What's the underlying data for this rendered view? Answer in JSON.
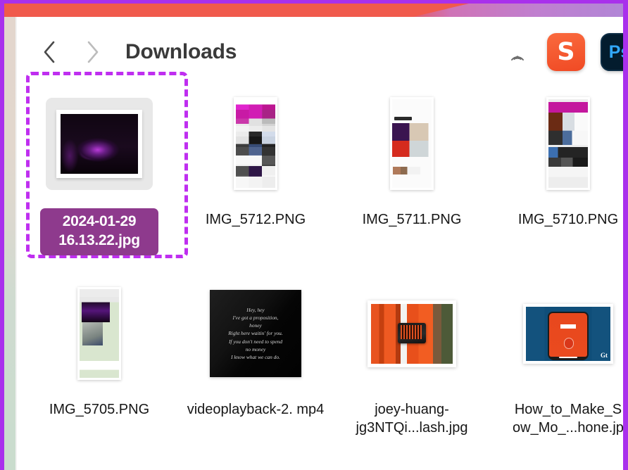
{
  "window": {
    "title": "Downloads",
    "nav": {
      "back_label": "Back",
      "forward_label": "Forward"
    }
  },
  "toolbar": {
    "airdrop_icon": "airdrop-icon",
    "apps": [
      {
        "name": "shottr-app-icon",
        "glyph": "S"
      },
      {
        "name": "photoshop-app-icon",
        "glyph": "Ps"
      }
    ]
  },
  "files": [
    {
      "name": "2024-01-29 16.13.22.jpg",
      "label_line1": "2024-01-29",
      "label_line2": "16.13.22.jpg",
      "selected": true,
      "kind": "photo-framed"
    },
    {
      "name": "IMG_5712.PNG",
      "selected": false,
      "kind": "phone-screenshot"
    },
    {
      "name": "IMG_5711.PNG",
      "selected": false,
      "kind": "phone-screenshot"
    },
    {
      "name": "IMG_5710.PNG",
      "selected": false,
      "kind": "phone-screenshot"
    },
    {
      "name": "IMG_5705.PNG",
      "selected": false,
      "kind": "phone-screenshot"
    },
    {
      "name": "videoplayback-2.\nmp4",
      "selected": false,
      "kind": "video-lyric-card",
      "lyrics": "Hey, hey\nI've got a proposition,\nhoney\nRight here waitin' for you.\nIf you don't need to spend\nno money\nI know what we can do."
    },
    {
      "name": "joey-huang-\njg3NTQi...lash.jpg",
      "selected": false,
      "kind": "photo"
    },
    {
      "name": "How_to_Make_S\now_Mo_...hone.jp",
      "selected": false,
      "kind": "photo",
      "watermark": "Gt"
    }
  ],
  "colors": {
    "selection_outline": "#bf2ef0",
    "selected_label_bg": "#8e3a8d",
    "banner_red": "#f05a4c",
    "banner_purple": "#b186d6",
    "frame_purple": "#a930ec",
    "shottr_orange": "#f04a24",
    "photoshop_blue": "#31a8ff"
  }
}
